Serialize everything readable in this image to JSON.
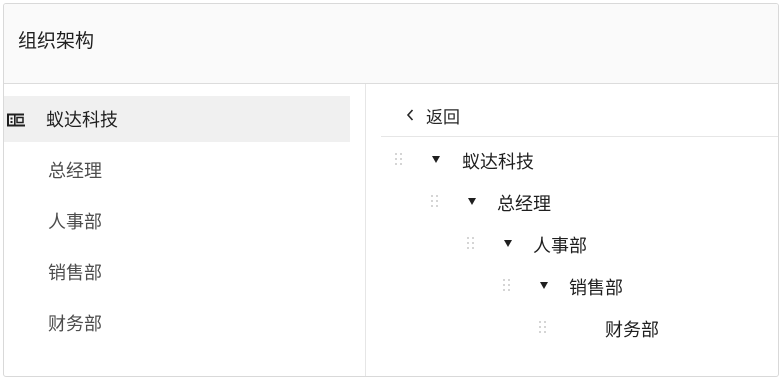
{
  "header": {
    "title": "组织架构"
  },
  "sidebar": {
    "company": "蚁达科技",
    "items": [
      {
        "label": "总经理"
      },
      {
        "label": "人事部"
      },
      {
        "label": "销售部"
      },
      {
        "label": "财务部"
      }
    ]
  },
  "main": {
    "back_label": "返回",
    "tree": [
      {
        "label": "蚁达科技",
        "expanded": true
      },
      {
        "label": "总经理",
        "expanded": true
      },
      {
        "label": "人事部",
        "expanded": true
      },
      {
        "label": "销售部",
        "expanded": true
      },
      {
        "label": "财务部",
        "expanded": false
      }
    ]
  },
  "icons": {
    "company": "building-icon",
    "back": "chevron-left-icon",
    "drag": "drag-handle-icon",
    "expand": "caret-down-icon"
  },
  "colors": {
    "active_row": "#f0f0f0",
    "header_bg": "#fafafa",
    "handle": "#c8c8c8"
  }
}
